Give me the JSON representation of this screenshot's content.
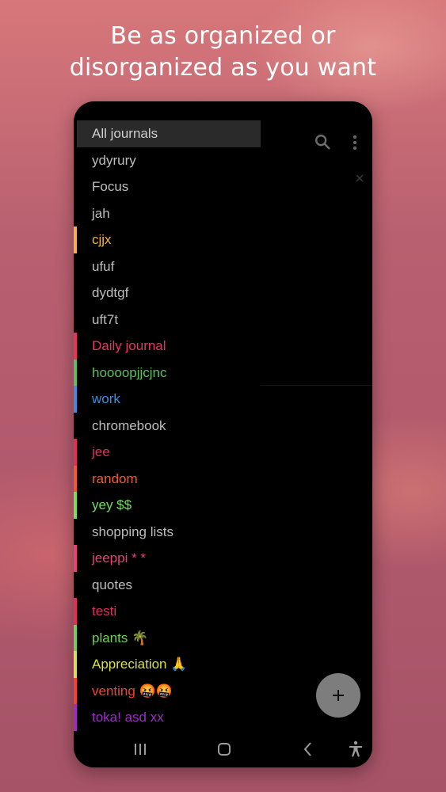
{
  "headline": {
    "line1": "Be as organized or",
    "line2": "disorganized as you want"
  },
  "colors": {
    "background_top": "#d7777a",
    "background_bottom": "#a65367",
    "drawer_selected": "#2a2a2a",
    "fab": "#7d7d7d"
  },
  "icons": {
    "search": "search-icon",
    "more": "more-vert-icon",
    "close": "close-icon",
    "fab": "plus-icon",
    "nav_recents": "recents-icon",
    "nav_home": "home-icon",
    "nav_back": "back-icon",
    "nav_accessibility": "accessibility-icon"
  },
  "drawer": {
    "items": [
      {
        "label": "All journals",
        "color": "#cfcfcf",
        "bar": null,
        "selected": true
      },
      {
        "label": "ydyrury",
        "color": "#bdbdbd",
        "bar": null
      },
      {
        "label": "Focus",
        "color": "#bdbdbd",
        "bar": null
      },
      {
        "label": "jah",
        "color": "#bdbdbd",
        "bar": null
      },
      {
        "label": "cjjx",
        "color": "#f2b33d",
        "bar": "#f2b33d"
      },
      {
        "label": "ufuf",
        "color": "#bdbdbd",
        "bar": null
      },
      {
        "label": "dydtgf",
        "color": "#bdbdbd",
        "bar": null
      },
      {
        "label": "uft7t",
        "color": "#bdbdbd",
        "bar": null
      },
      {
        "label": "Daily journal",
        "color": "#e8335e",
        "bar": "#e8335e"
      },
      {
        "label": "hoooopjjcjnc",
        "color": "#5bbf5b",
        "bar": "#5bbf5b"
      },
      {
        "label": "work",
        "color": "#3d8ee0",
        "bar": "#3d8ee0"
      },
      {
        "label": "chromebook",
        "color": "#bdbdbd",
        "bar": null
      },
      {
        "label": "jee",
        "color": "#e0305a",
        "bar": "#e0305a"
      },
      {
        "label": "random",
        "color": "#f25a2e",
        "bar": "#f25a2e"
      },
      {
        "label": "yey $$",
        "color": "#72e05a",
        "bar": "#72e05a"
      },
      {
        "label": "shopping lists",
        "color": "#bdbdbd",
        "bar": null
      },
      {
        "label": "jeeppi * *",
        "color": "#e8407a",
        "bar": "#e8407a"
      },
      {
        "label": "quotes",
        "color": "#bdbdbd",
        "bar": null
      },
      {
        "label": "testi",
        "color": "#e0305a",
        "bar": "#e0305a"
      },
      {
        "label": "plants 🌴",
        "color": "#6fcf5a",
        "bar": "#6fcf5a"
      },
      {
        "label": "Appreciation 🙏",
        "color": "#d8e048",
        "bar": "#d8e048"
      },
      {
        "label": "venting 🤬🤬",
        "color": "#f2432e",
        "bar": "#f2432e"
      },
      {
        "label": "toka! asd xx",
        "color": "#9a2fc0",
        "bar": "#9a2fc0"
      }
    ]
  }
}
